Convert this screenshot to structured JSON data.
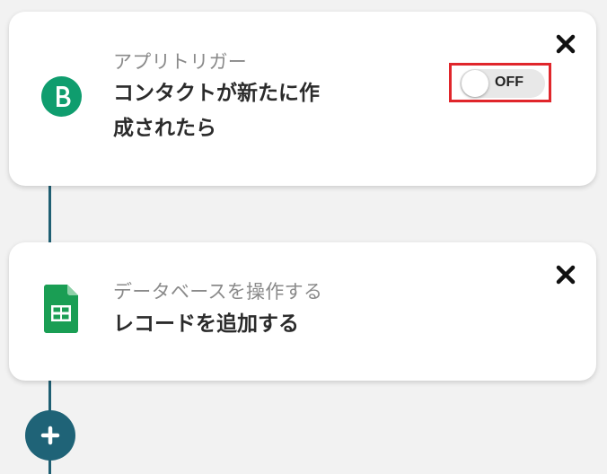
{
  "flow": {
    "steps": [
      {
        "subtitle": "アプリトリガー",
        "title_line1": "コンタクトが新たに作",
        "title_line2": "成されたら",
        "icon": "brevo-b-icon",
        "icon_color": "#0f9d6e",
        "toggle": {
          "state": "off",
          "label": "OFF"
        }
      },
      {
        "subtitle": "データベースを操作する",
        "title_line1": "レコードを追加する",
        "icon": "google-sheets-icon",
        "icon_color": "#1a9e54"
      }
    ],
    "connector_color": "#1f5f73",
    "add_button_color": "#1f6377",
    "highlight_color": "#e0262b"
  }
}
